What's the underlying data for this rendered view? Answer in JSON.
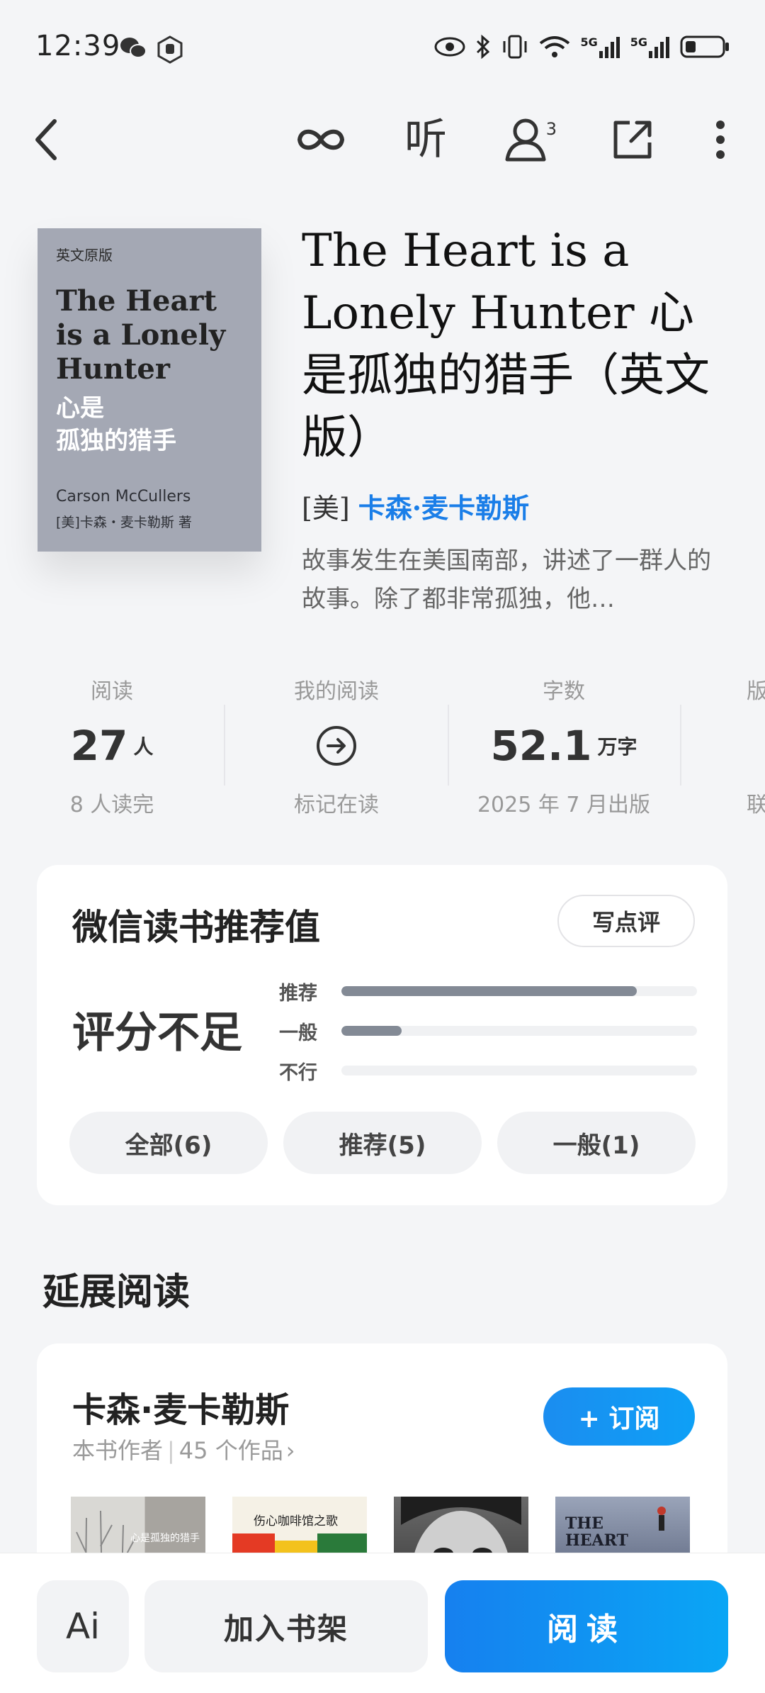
{
  "status": {
    "time": "12:39",
    "network1": "5G",
    "network2": "5G"
  },
  "nav": {
    "listen_label": "听",
    "share_badge": "3"
  },
  "cover": {
    "edition": "英文原版",
    "title_en": "The Heart is a Lonely Hunter",
    "title_cn_line1": "心是",
    "title_cn_line2": "孤独的猎手",
    "author_en": "Carson McCullers",
    "author_cn": "[美]卡森・麦卡勒斯 著"
  },
  "book": {
    "title": "The Heart is a Lonely Hunter 心是孤独的猎手（英文版）",
    "author_prefix": "[美]",
    "author_name": "卡森·麦卡勒斯",
    "description": "故事发生在美国南部，讲述了一群人的故事。除了都非常孤独，他…"
  },
  "stats": [
    {
      "label": "阅读",
      "value": "27",
      "unit": "人",
      "sub": "8 人读完"
    },
    {
      "label": "我的阅读",
      "value": "",
      "unit": "",
      "sub": "标记在读"
    },
    {
      "label": "字数",
      "value": "52.1",
      "unit": "万字",
      "sub": "2025 年 7 月出版"
    },
    {
      "label": "版",
      "value": "",
      "unit": "",
      "sub": "联"
    }
  ],
  "rating": {
    "title": "微信读书推荐值",
    "write_review": "写点评",
    "status": "评分不足",
    "bars": [
      {
        "label": "推荐",
        "fraction": 0.83
      },
      {
        "label": "一般",
        "fraction": 0.17
      },
      {
        "label": "不行",
        "fraction": 0.0
      }
    ],
    "filters": [
      "全部(6)",
      "推荐(5)",
      "一般(1)"
    ]
  },
  "extended": {
    "section_title": "延展阅读",
    "author_name": "卡森·麦卡勒斯",
    "author_role": "本书作者",
    "works_count": "45 个作品",
    "subscribe_label": "+ 订阅",
    "thumbs": [
      {
        "title": "心是孤独的猎手",
        "colors": [
          "#d9d8d4",
          "#a7a49f"
        ]
      },
      {
        "title": "伤心咖啡馆之歌",
        "colors": [
          "#f5f1e6",
          "#e43a24"
        ]
      },
      {
        "title": "",
        "colors": [
          "#6a6a6a",
          "#2a2a2a"
        ]
      },
      {
        "title": "THE HEART",
        "colors": [
          "#9aa4b9",
          "#3b4560"
        ]
      }
    ]
  },
  "bottom": {
    "ai_label": "Ai",
    "shelf_label": "加入书架",
    "read_label": "阅读"
  },
  "colors": {
    "accent_blue": "#1a7ee8",
    "bar_fill": "#838a95"
  }
}
